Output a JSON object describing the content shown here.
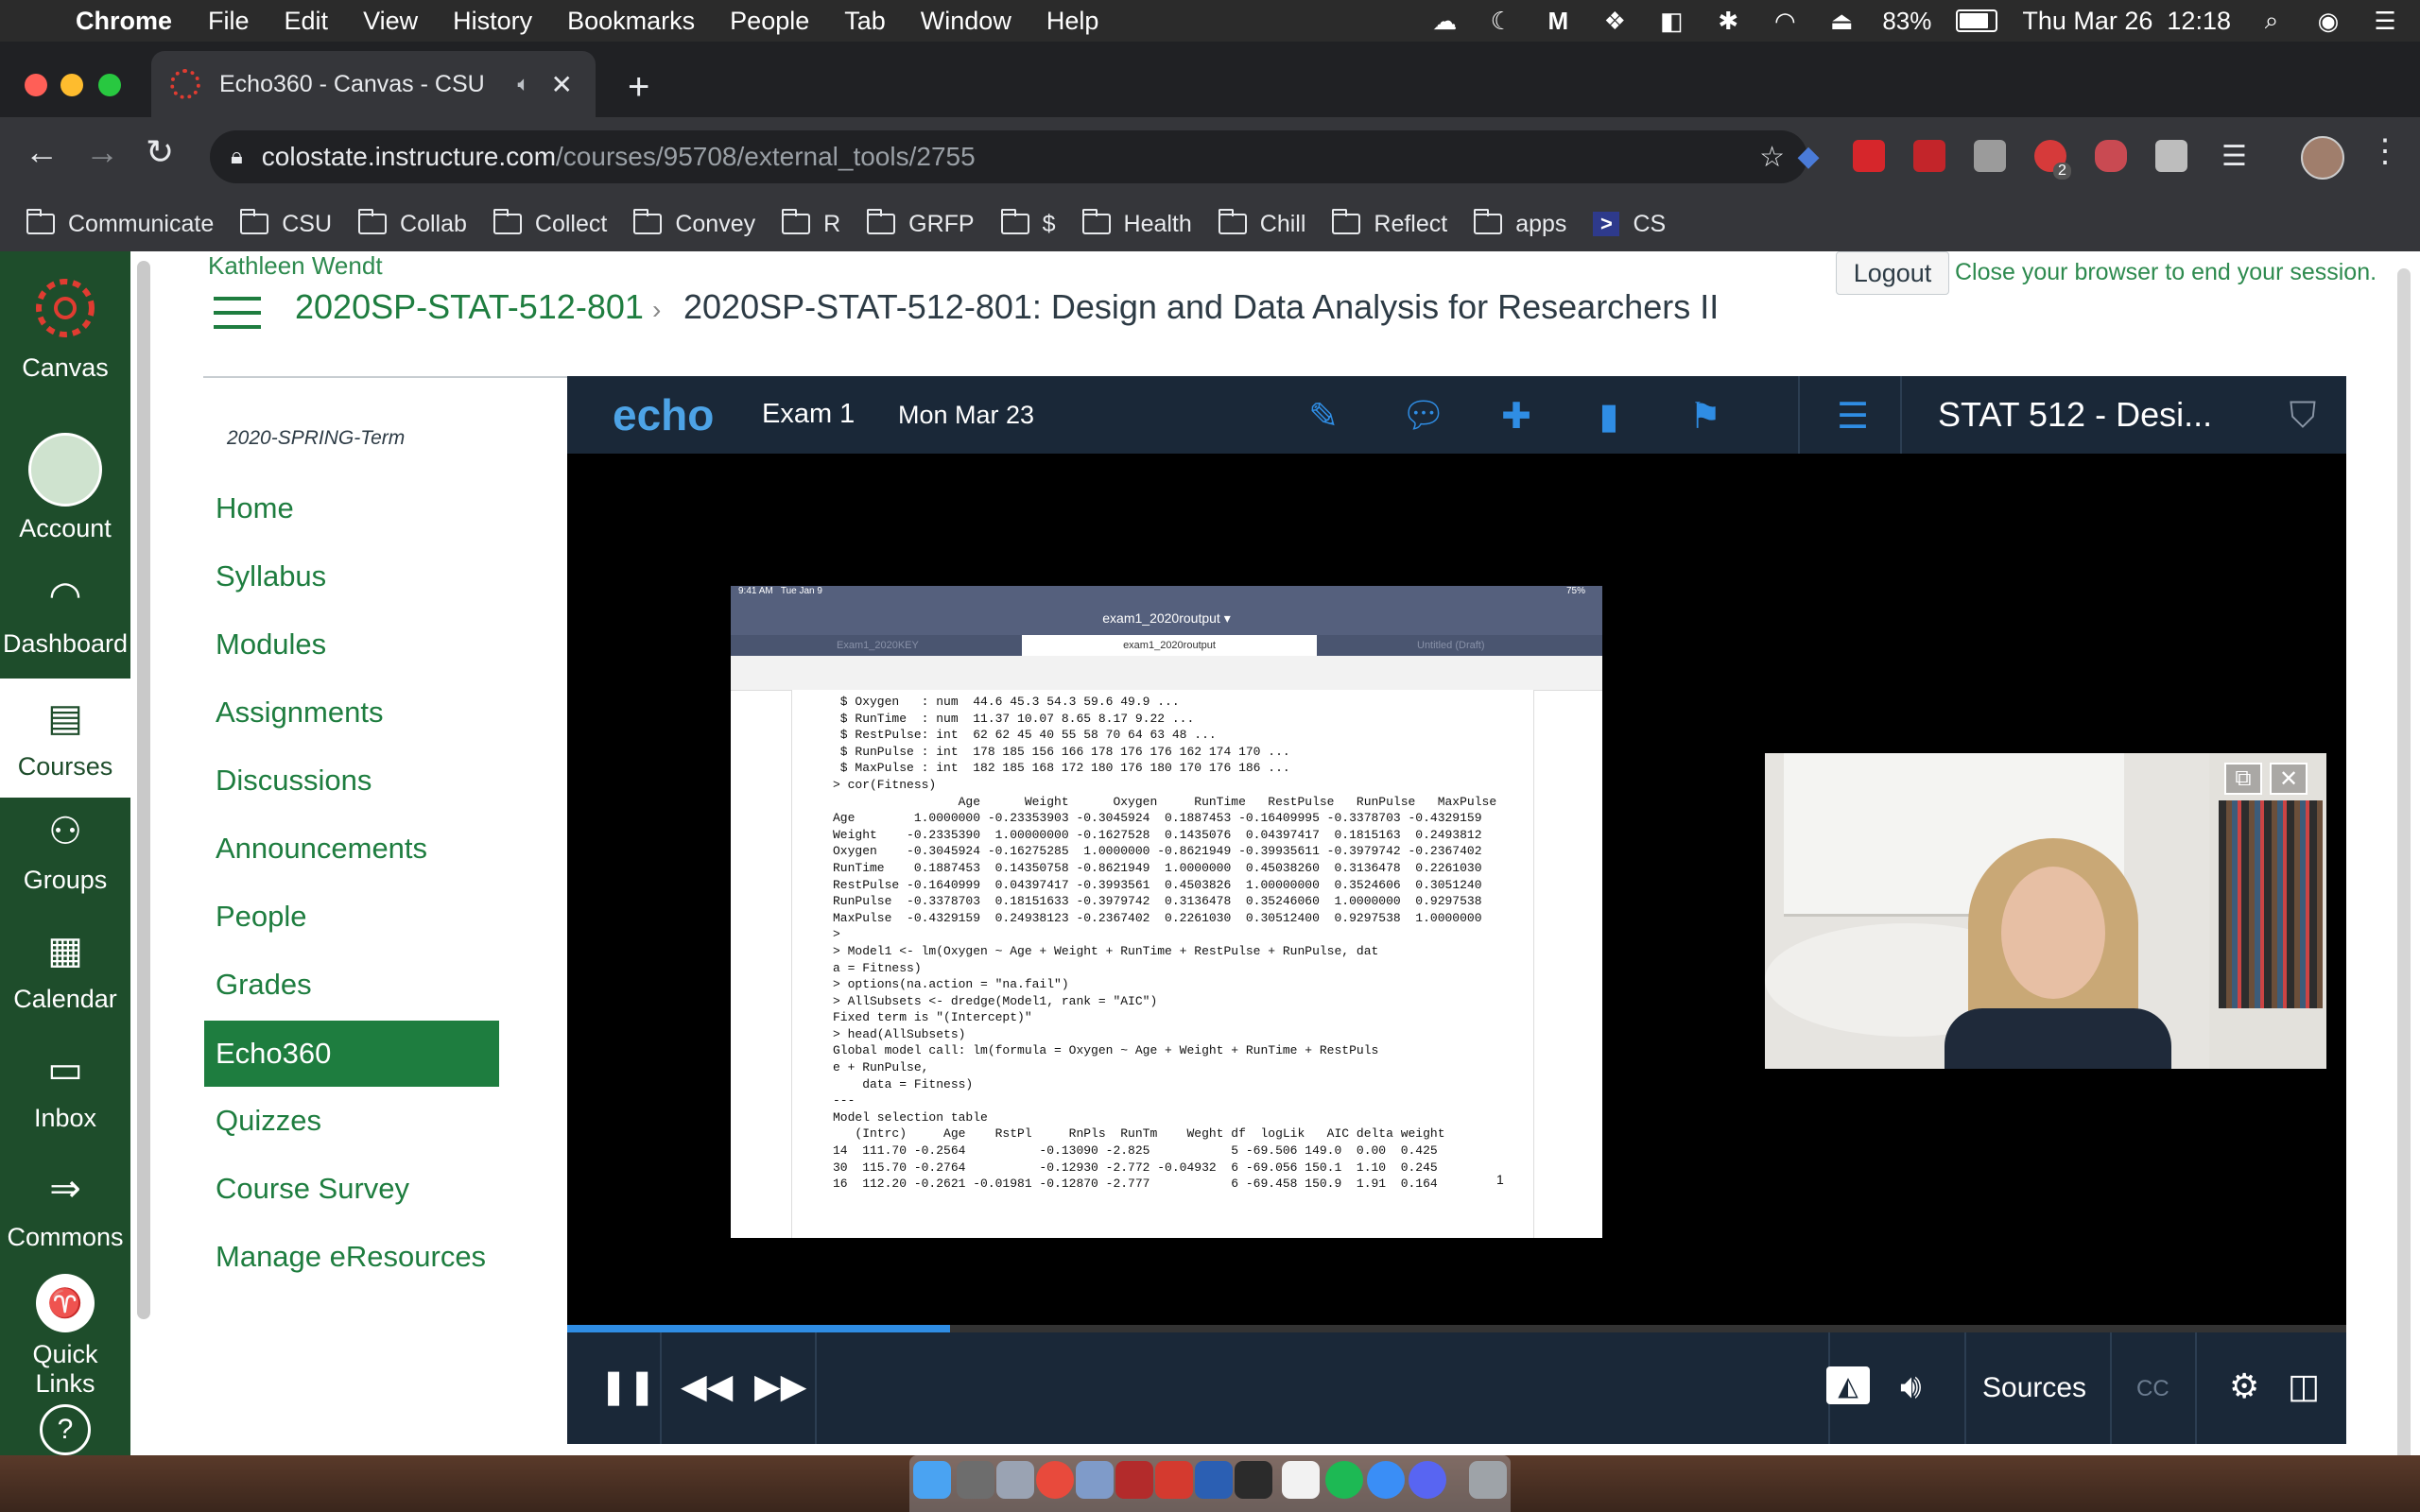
{
  "menubar": {
    "app_name": "Chrome",
    "menus": [
      "File",
      "Edit",
      "View",
      "History",
      "Bookmarks",
      "People",
      "Tab",
      "Window",
      "Help"
    ],
    "battery": "83%",
    "battery_level": 0.83,
    "datetime": "Thu Mar 26  12:18"
  },
  "browser": {
    "tab_title": "Echo360 - Canvas - CSU",
    "url_host": "colostate.instructure.com",
    "url_path": "/courses/95708/external_tools/2755",
    "extension_badge": "2",
    "bookmarks": [
      "Communicate",
      "CSU",
      "Collab",
      "Collect",
      "Convey",
      "R",
      "GRFP",
      "$",
      "Health",
      "Chill",
      "Reflect",
      "apps"
    ],
    "bookmark_cs": "CS"
  },
  "canvas": {
    "global_nav": [
      {
        "label": "Canvas",
        "icon": "canvas-logo-icon"
      },
      {
        "label": "Account",
        "icon": "account-avatar-icon"
      },
      {
        "label": "Dashboard",
        "icon": "dashboard-icon"
      },
      {
        "label": "Courses",
        "icon": "courses-icon"
      },
      {
        "label": "Groups",
        "icon": "groups-icon"
      },
      {
        "label": "Calendar",
        "icon": "calendar-icon"
      },
      {
        "label": "Inbox",
        "icon": "inbox-icon"
      },
      {
        "label": "Commons",
        "icon": "commons-icon"
      },
      {
        "label": "Quick Links",
        "icon": "quick-links-icon"
      },
      {
        "label": "",
        "icon": "help-icon"
      }
    ],
    "user_name": "Kathleen Wendt",
    "breadcrumb_course": "2020SP-STAT-512-801",
    "breadcrumb_sep": "›",
    "page_title": "2020SP-STAT-512-801: Design and Data Analysis for Researchers II",
    "logout_label": "Logout",
    "session_note": "Close your browser to end your session.",
    "term": "2020-SPRING-Term",
    "course_nav": [
      "Home",
      "Syllabus",
      "Modules",
      "Assignments",
      "Discussions",
      "Announcements",
      "People",
      "Grades",
      "Echo360",
      "Quizzes",
      "Course Survey",
      "Manage eResources"
    ],
    "course_nav_active": "Echo360"
  },
  "player": {
    "logo": "echo",
    "exam_title": "Exam 1",
    "exam_date": "Mon Mar 23",
    "course_label": "STAT 512 - Desi...",
    "progress": 0.215,
    "sources_label": "Sources",
    "cc_label": "CC",
    "accent": "#2f8de4",
    "slide": {
      "status_time": "9:41 AM   Tue Jan 9",
      "status_battery": "75%",
      "doc_title": "exam1_2020routput ▾",
      "tabs": [
        "Exam1_2020KEY",
        "exam1_2020routput",
        "Untitled (Draft)"
      ],
      "code": " $ Oxygen   : num  44.6 45.3 54.3 59.6 49.9 ...\n $ RunTime  : num  11.37 10.07 8.65 8.17 9.22 ...\n $ RestPulse: int  62 62 45 40 55 58 70 64 63 48 ...\n $ RunPulse : int  178 185 156 166 178 176 176 162 174 170 ...\n $ MaxPulse : int  182 185 168 172 180 176 180 170 176 186 ...\n> cor(Fitness)\n                 Age      Weight      Oxygen     RunTime   RestPulse   RunPulse   MaxPulse\nAge        1.0000000 -0.23353903 -0.3045924  0.1887453 -0.16409995 -0.3378703 -0.4329159\nWeight    -0.2335390  1.00000000 -0.1627528  0.1435076  0.04397417  0.1815163  0.2493812\nOxygen    -0.3045924 -0.16275285  1.0000000 -0.8621949 -0.39935611 -0.3979742 -0.2367402\nRunTime    0.1887453  0.14350758 -0.8621949  1.0000000  0.45038260  0.3136478  0.2261030\nRestPulse -0.1640999  0.04397417 -0.3993561  0.4503826  1.00000000  0.3524606  0.3051240\nRunPulse  -0.3378703  0.18151633 -0.3979742  0.3136478  0.35246060  1.0000000  0.9297538\nMaxPulse  -0.4329159  0.24938123 -0.2367402  0.2261030  0.30512400  0.9297538  1.0000000\n>\n> Model1 <- lm(Oxygen ~ Age + Weight + RunTime + RestPulse + RunPulse, dat\na = Fitness)\n> options(na.action = \"na.fail\")\n> AllSubsets <- dredge(Model1, rank = \"AIC\")\nFixed term is \"(Intercept)\"\n> head(AllSubsets)\nGlobal model call: lm(formula = Oxygen ~ Age + Weight + RunTime + RestPuls\ne + RunPulse,\n    data = Fitness)\n---\nModel selection table\n   (Intrc)     Age    RstPl     RnPls  RunTm    Weght df  logLik   AIC delta weight\n14  111.70 -0.2564          -0.13090 -2.825           5 -69.506 149.0  0.00  0.425\n30  115.70 -0.2764          -0.12930 -2.772 -0.04932  6 -69.056 150.1  1.10  0.245\n16  112.20 -0.2621 -0.01981 -0.12870 -2.777           6 -69.458 150.9  1.91  0.164",
      "page_number": "1"
    }
  }
}
